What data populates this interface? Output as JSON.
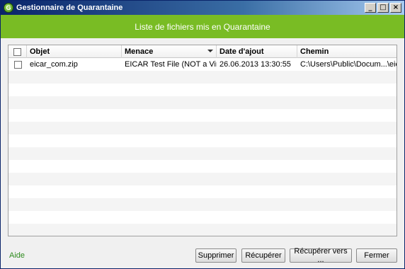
{
  "window": {
    "title": "Gestionnaire de Quarantaine"
  },
  "banner": {
    "text": "Liste de fichiers mis en Quarantaine"
  },
  "table": {
    "columns": [
      "",
      "Objet",
      "Menace",
      "Date d'ajout",
      "Chemin"
    ],
    "sorted_column": "Menace",
    "rows": [
      {
        "checked": false,
        "object": "eicar_com.zip",
        "threat": "EICAR Test File (NOT a Vir...",
        "date": "26.06.2013 13:30:55",
        "path": "C:\\Users\\Public\\Docum...\\eicar"
      }
    ]
  },
  "footer": {
    "help_label": "Aide",
    "buttons": {
      "delete": "Supprimer",
      "restore": "Récupérer",
      "restore_to": "Récupérer vers ...",
      "close": "Fermer"
    }
  },
  "colors": {
    "banner": "#79bc24",
    "title_bar": "#0a246a",
    "help_link": "#2e8b1e"
  }
}
